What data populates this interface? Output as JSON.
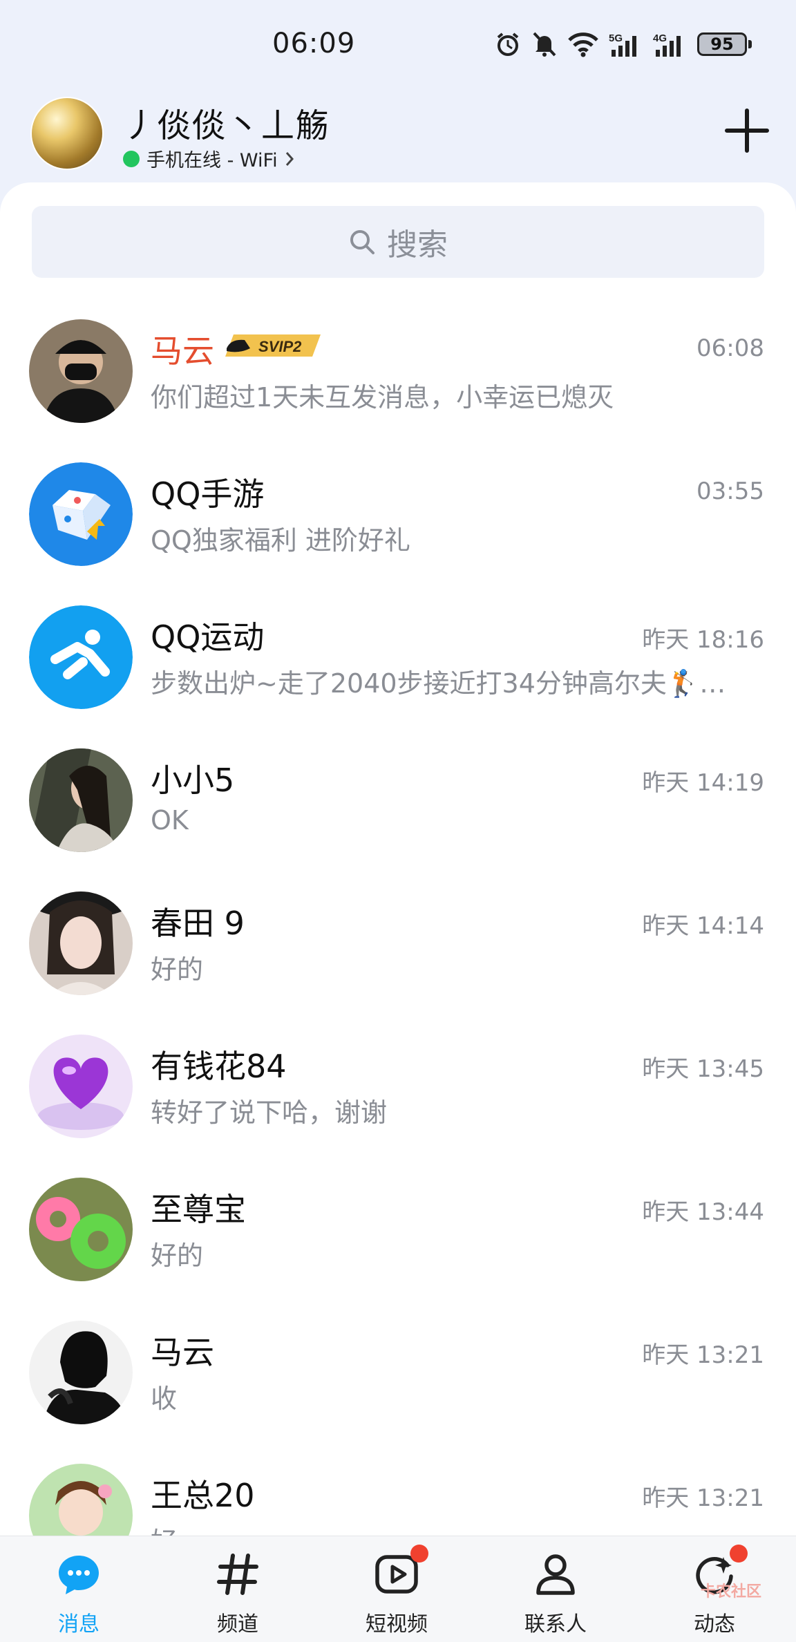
{
  "status_bar": {
    "time": "06:09",
    "battery": "95",
    "network_5g": "5G",
    "network_4g": "4G"
  },
  "profile": {
    "name": "丿倓倓丶丄觞",
    "status_text": "手机在线 - WiFi",
    "status_color": "#22c55e"
  },
  "search": {
    "placeholder": "搜索"
  },
  "conversations": [
    {
      "name": "马云",
      "message": "你们超过1天未互发消息，小幸运已熄灭",
      "time": "06:08",
      "badge": "SVIP2",
      "name_color": "#e44d2e"
    },
    {
      "name": "QQ手游",
      "message": "QQ独家福利  进阶好礼",
      "time": "03:55"
    },
    {
      "name": "QQ运动",
      "message": "步数出炉~走了2040步接近打34分钟高尔夫🏌…",
      "time": "昨天 18:16"
    },
    {
      "name": "小小5",
      "message": "OK",
      "time": "昨天 14:19"
    },
    {
      "name": "春田 9",
      "message": "好的",
      "time": "昨天 14:14"
    },
    {
      "name": "有钱花84",
      "message": "转好了说下哈，谢谢",
      "time": "昨天 13:45"
    },
    {
      "name": "至尊宝",
      "message": "好的",
      "time": "昨天 13:44"
    },
    {
      "name": "马云",
      "message": "收",
      "time": "昨天 13:21"
    },
    {
      "name": "王总20",
      "message": "好",
      "time": "昨天 13:21"
    }
  ],
  "bottom_nav": {
    "items": [
      {
        "label": "消息",
        "icon": "message-icon",
        "active": true
      },
      {
        "label": "频道",
        "icon": "hashtag-icon"
      },
      {
        "label": "短视频",
        "icon": "video-icon",
        "badge_dot": true
      },
      {
        "label": "联系人",
        "icon": "contact-icon"
      },
      {
        "label": "动态",
        "icon": "moments-icon",
        "badge_dot": true
      }
    ],
    "active_color": "#12a3f5"
  },
  "watermark": "卡农社区"
}
